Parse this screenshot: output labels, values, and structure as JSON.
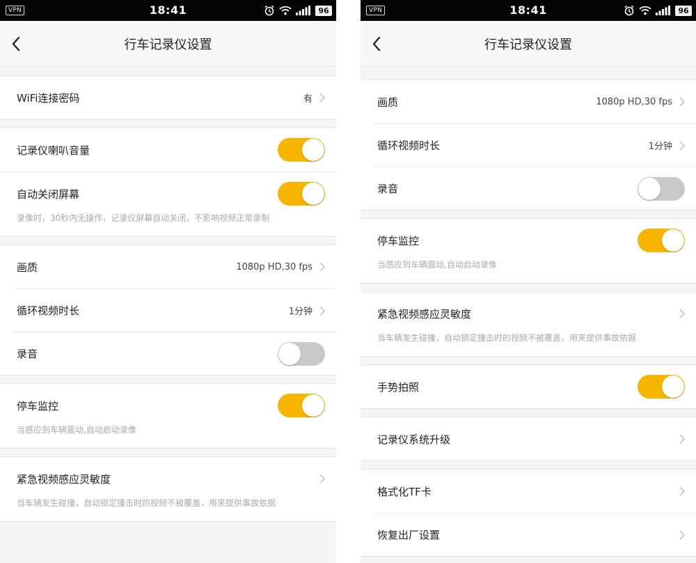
{
  "status_bar": {
    "vpn": "VPN",
    "time": "18:41",
    "battery": "96"
  },
  "nav": {
    "title": "行车记录仪设置"
  },
  "colors": {
    "accent": "#f7b500",
    "toggle_off": "#c9c9c9"
  },
  "left": {
    "wifi_label": "WiFi连接密码",
    "wifi_value": "有",
    "speaker_label": "记录仪喇叭音量",
    "speaker_on": true,
    "screen_off_label": "自动关闭屏幕",
    "screen_off_on": true,
    "screen_off_desc": "录像时，30秒内无操作，记录仪屏幕自动关闭，不影响视频正常录制",
    "quality_label": "画质",
    "quality_value": "1080p HD,30 fps",
    "loop_label": "循环视频时长",
    "loop_value": "1分钟",
    "audio_label": "录音",
    "audio_on": false,
    "parking_label": "停车监控",
    "parking_on": true,
    "parking_desc": "当感应到车辆震动,自动启动录像",
    "emergency_label": "紧急视频感应灵敏度",
    "emergency_desc": "当车辆发生碰撞，自动锁定撞击时的视频不被覆盖，用来提供事故依据"
  },
  "right": {
    "quality_label": "画质",
    "quality_value": "1080p HD,30 fps",
    "loop_label": "循环视频时长",
    "loop_value": "1分钟",
    "audio_label": "录音",
    "audio_on": false,
    "parking_label": "停车监控",
    "parking_on": true,
    "parking_desc": "当感应到车辆震动,自动启动录像",
    "emergency_label": "紧急视频感应灵敏度",
    "emergency_desc": "当车辆发生碰撞，自动锁定撞击时的视频不被覆盖，用来提供事故依据",
    "gesture_label": "手势拍照",
    "gesture_on": true,
    "upgrade_label": "记录仪系统升级",
    "format_label": "格式化TF卡",
    "reset_label": "恢复出厂设置"
  }
}
